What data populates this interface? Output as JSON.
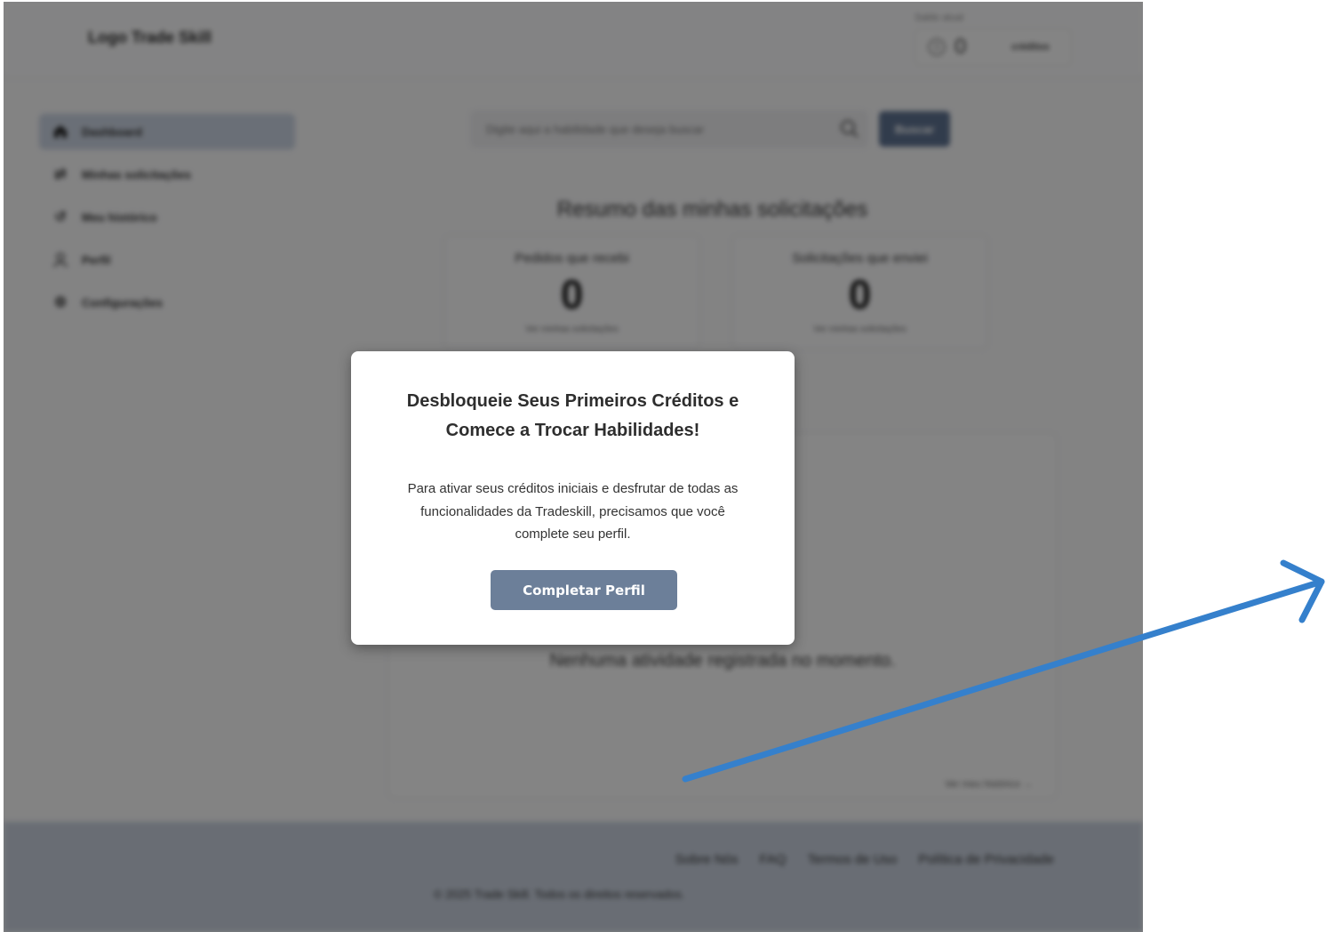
{
  "header": {
    "logo_text": "Logo Trade Skill",
    "balance_label": "Saldo atual",
    "balance_amount": "0",
    "balance_unit": "créditos"
  },
  "sidebar": {
    "items": [
      {
        "label": "Dashboard",
        "icon": "home-icon",
        "active": true
      },
      {
        "label": "Minhas solicitações",
        "icon": "exchange-icon"
      },
      {
        "label": "Meu histórico",
        "icon": "history-icon"
      },
      {
        "label": "Perfil",
        "icon": "user-icon"
      },
      {
        "label": "Configurações",
        "icon": "gear-icon"
      }
    ]
  },
  "search": {
    "placeholder": "Digite aqui a habilidade que deseja buscar",
    "button_label": "Buscar"
  },
  "summary": {
    "title": "Resumo das minhas solicitações",
    "cards": [
      {
        "title": "Pedidos que recebi",
        "count": "0",
        "link": "Ver minhas solicitações"
      },
      {
        "title": "Solicitações que enviei",
        "count": "0",
        "link": "Ver minhas solicitações"
      }
    ]
  },
  "activity": {
    "empty_text": "Nenhuma atividade registrada no momento.",
    "history_link": "Ver meu histórico"
  },
  "footer": {
    "links": [
      "Sobre Nós",
      "FAQ",
      "Termos de Uso",
      "Política de Privacidade"
    ],
    "copyright": "© 2025 Trade Skill. Todos os direitos reservados."
  },
  "modal": {
    "title": "Desbloqueie Seus Primeiros Créditos e Comece a Trocar Habilidades!",
    "body": "Para ativar seus créditos iniciais e desfrutar de todas as funcionalidades da Tradeskill, precisamos que você complete seu perfil.",
    "button_label": "Completar Perfil"
  },
  "colors": {
    "accent": "#6c7f99",
    "arrow": "#3580cc",
    "overlay": "#000000"
  }
}
